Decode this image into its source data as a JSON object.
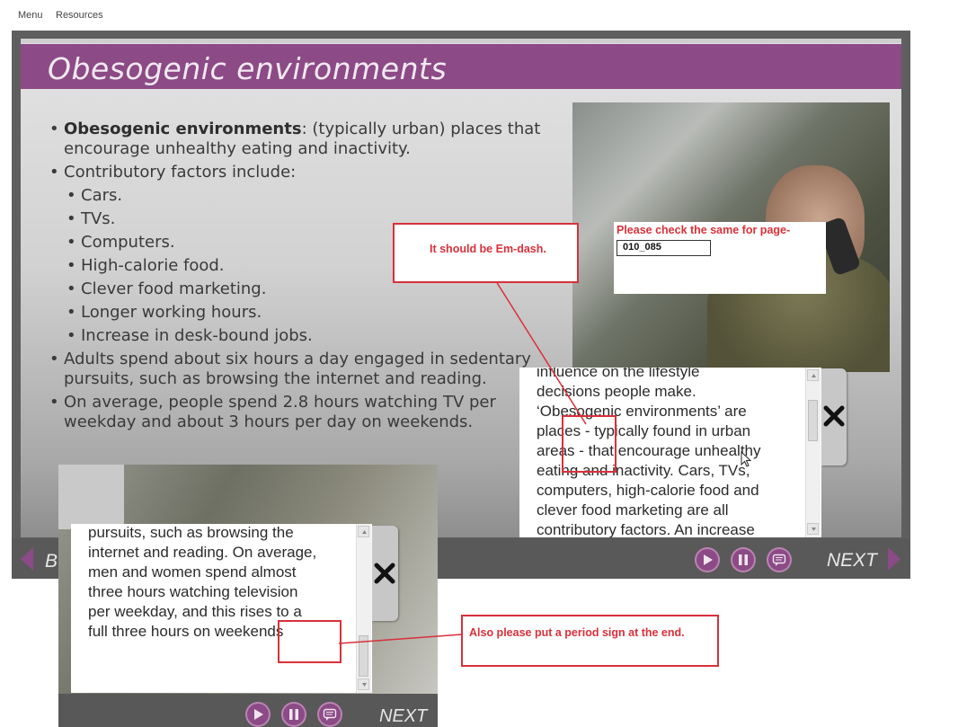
{
  "menu": {
    "menu_label": "Menu",
    "resources_label": "Resources"
  },
  "slide": {
    "title": "Obesogenic environments",
    "bullets": {
      "b1_bold": "Obesogenic environments",
      "b1_rest": ": (typically urban) places that encourage unhealthy eating and inactivity.",
      "b2": "Contributory factors include:",
      "sub1": "Cars.",
      "sub2": "TVs.",
      "sub3": "Computers.",
      "sub4": "High-calorie food.",
      "sub5": "Clever food marketing.",
      "sub6": "Longer working hours.",
      "sub7": "Increase in desk-bound jobs.",
      "b3": "Adults spend about six hours a day engaged in sedentary pursuits, such as browsing the internet and reading.",
      "b4": "On average, people spend 2.8 hours watching TV per weekday and about 3 hours per day on weekends."
    }
  },
  "player": {
    "next_label": "NEXT",
    "back_label": "B",
    "play_icon": "play-icon",
    "pause_icon": "pause-icon",
    "transcript_icon": "transcript-icon",
    "accent_color": "#8c4a86"
  },
  "transcript_right": {
    "lines": [
      "influence on the lifestyle",
      "decisions people make.",
      "‘Obesogenic environments’ are",
      "places - typically found in urban",
      "areas - that encourage unhealthy",
      "eating and inactivity. Cars, TVs,",
      "computers, high-calorie food and",
      "clever food marketing are all",
      "contributory factors. An increase"
    ]
  },
  "transcript_left": {
    "lines": [
      "pursuits, such as browsing the",
      "internet and reading. On average,",
      "men and women spend almost",
      "three hours watching television",
      "per weekday, and this rises to a",
      "full three hours on weekends"
    ]
  },
  "player2": {
    "next_label": "NEXT"
  },
  "annotations": {
    "em_dash_note": "It should be Em-dash.",
    "check_page_note": "Please check the same for page-",
    "page_code": "010_085",
    "period_note": "Also please put a period sign at the end.",
    "annotation_color": "#d9303a"
  }
}
